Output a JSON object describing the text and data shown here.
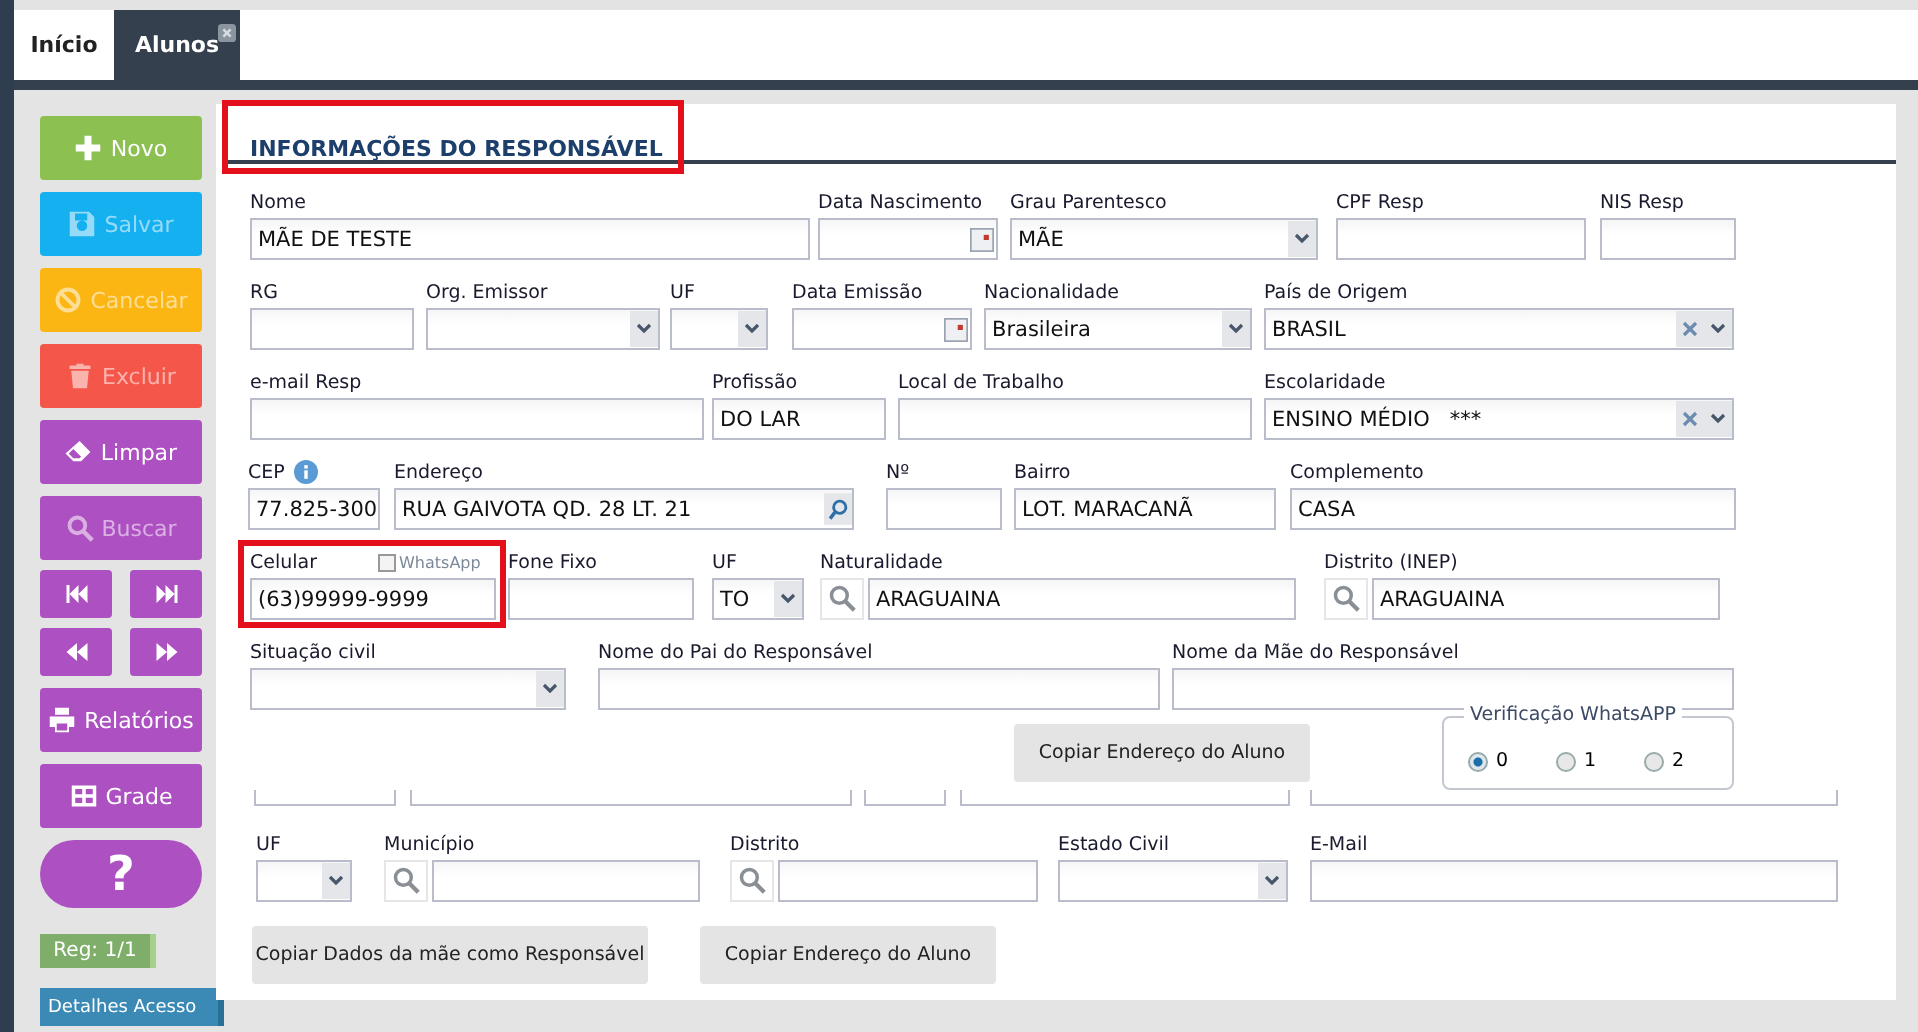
{
  "tabs": [
    {
      "label": "Início",
      "selected": false
    },
    {
      "label": "Alunos",
      "selected": true,
      "closable": true
    }
  ],
  "sidebar": {
    "actions": [
      {
        "label": "Novo",
        "color": "#8cc152",
        "disabled": false
      },
      {
        "label": "Salvar",
        "color": "#15b0f0",
        "disabled": true
      },
      {
        "label": "Cancelar",
        "color": "#fbb614",
        "disabled": true
      },
      {
        "label": "Excluir",
        "color": "#f5564a",
        "disabled": true
      },
      {
        "label": "Limpar",
        "color": "#ad50c1",
        "disabled": false
      },
      {
        "label": "Buscar",
        "color": "#ad50c1",
        "disabled": true
      }
    ],
    "reports": {
      "label": "Relatórios"
    },
    "grid": {
      "label": "Grade"
    },
    "help": {
      "label": "?"
    },
    "record_badge": "Reg: 1/1",
    "access_details": "Detalhes Acesso"
  },
  "form": {
    "title": {
      "text": "INFORMAÇÕES DO RESPONSÁVEL",
      "highlighted": true
    },
    "field_lines": [
      {
        "fields": [
          {
            "kind": "text",
            "label": "Nome",
            "value": "MÃE DE TESTE"
          },
          {
            "kind": "date",
            "label": "Data Nascimento"
          },
          {
            "kind": "select",
            "label": "Grau Parentesco",
            "value": "MÃE"
          },
          {
            "kind": "text",
            "label": "CPF Resp"
          },
          {
            "kind": "text",
            "label": "NIS Resp"
          }
        ]
      },
      {
        "fields": [
          {
            "kind": "text",
            "label": "RG"
          },
          {
            "kind": "select",
            "label": "Org. Emissor"
          },
          {
            "kind": "select",
            "label": "UF"
          },
          {
            "kind": "date",
            "label": "Data Emissão"
          },
          {
            "kind": "select",
            "label": "Nacionalidade",
            "value": "Brasileira"
          },
          {
            "kind": "combo",
            "label": "País de Origem",
            "value": "BRASIL"
          }
        ]
      },
      {
        "fields": [
          {
            "kind": "text",
            "label": "e-mail Resp"
          },
          {
            "kind": "text",
            "label": "Profissão",
            "value": "DO LAR"
          },
          {
            "kind": "text",
            "label": "Local de Trabalho"
          },
          {
            "kind": "combo",
            "label": "Escolaridade",
            "value": "ENSINO MÉDIO   ***"
          }
        ]
      },
      {
        "fields": [
          {
            "kind": "info",
            "label": "CEP",
            "value": "77.825-300"
          },
          {
            "kind": "lookup",
            "label": "Endereço",
            "value": "RUA GAIVOTA QD. 28 LT. 21"
          },
          {
            "kind": "text",
            "label": "Nº"
          },
          {
            "kind": "text",
            "label": "Bairro",
            "value": "LOT. MARACANÃ"
          },
          {
            "kind": "text",
            "label": "Complemento",
            "value": "CASA"
          }
        ]
      },
      {
        "fields": [
          {
            "kind": "phone",
            "label": "Celular",
            "value": "(63)99999-9999",
            "highlighted": true,
            "option": {
              "label": "WhatsApp",
              "checked": false
            }
          },
          {
            "kind": "text",
            "label": "Fone Fixo"
          },
          {
            "kind": "select",
            "label": "UF",
            "value": "TO"
          },
          {
            "kind": "search",
            "label": "Naturalidade",
            "value": "ARAGUAINA"
          },
          {
            "kind": "search",
            "label": "Distrito (INEP)",
            "value": "ARAGUAINA"
          }
        ]
      },
      {
        "fields": [
          {
            "kind": "select",
            "label": "Situação civil"
          },
          {
            "kind": "text",
            "label": "Nome do Pai do Responsável"
          },
          {
            "kind": "text",
            "label": "Nome da Mãe do Responsável"
          }
        ]
      }
    ],
    "copy_address_button": "Copiar Endereço do Aluno",
    "whatsapp_check": {
      "legend": "Verificação WhatsAPP",
      "options": [
        {
          "label": "0",
          "selected": true
        },
        {
          "label": "1",
          "selected": false
        },
        {
          "label": "2",
          "selected": false
        }
      ]
    },
    "lower_fields": [
      {
        "kind": "select",
        "label": "UF"
      },
      {
        "kind": "search",
        "label": "Município"
      },
      {
        "kind": "search",
        "label": "Distrito"
      },
      {
        "kind": "select",
        "label": "Estado Civil"
      },
      {
        "kind": "text",
        "label": "E-Mail"
      }
    ],
    "buttons": [
      "Copiar Dados da mãe como Responsável",
      "Copiar Endereço do Aluno"
    ]
  }
}
